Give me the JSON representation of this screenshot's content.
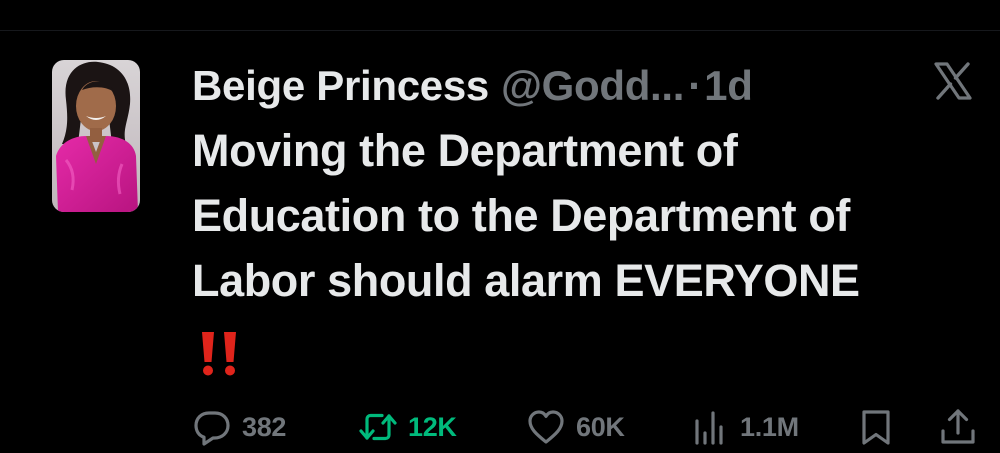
{
  "tweet": {
    "display_name": "Beige Princess",
    "handle": "@Godd...",
    "separator": "·",
    "time": "1d",
    "text_lines": [
      "Moving the Department of",
      "Education to the Department of",
      "Labor should alarm EVERYONE"
    ],
    "emoji": "double-exclamation-mark",
    "platform_icon": "x-logo-icon"
  },
  "actions": {
    "replies": "382",
    "reposts": "12K",
    "likes": "60K",
    "views": "1.1M"
  },
  "colors": {
    "background": "#000000",
    "primary_text": "#e7e9ea",
    "secondary_text": "#71767b",
    "repost_active": "#00ba7c",
    "emoji_red": "#e0241b"
  }
}
